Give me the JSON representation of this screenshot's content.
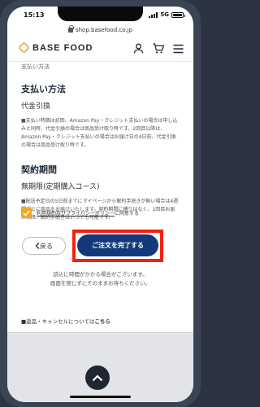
{
  "status": {
    "time": "15:13",
    "network": "5G"
  },
  "browser": {
    "url": "shop.basefood.co.jp"
  },
  "header": {
    "logo_text": "BASE FOOD"
  },
  "content": {
    "cut_text": "支払い方法",
    "payment_title": "支払い方法",
    "payment_value": "代金引換",
    "payment_note": "■支払い時期は初回、Amazon Pay・クレジット支払いの場合は申し込みと同時、代金引換の場合は商品受け取り時です。2回目以降は、Amazon Pay・クレジット支払いの場合はお届け日の4日前、代金引換の場合は商品受け取り時です。",
    "period_title": "契約期間",
    "period_value": "無期限(定期購入コース)",
    "period_note": "■配送予定日の5日前までにマイページから解約手続きが無い場合は4週間ごとに商品をお届けいたします。契約期間に縛りはなく、1回目お届け以降、解約手続きはいつでも可能です。"
  },
  "agree": {
    "link_text": "利用規約及びプライバシーポリシー",
    "suffix": "に同意する"
  },
  "buttons": {
    "back_label": "戻る",
    "submit_label": "ご注文を完了する"
  },
  "wait_text": {
    "line1": "読込に時間がかかる場合がございます。",
    "line2": "画面を閉じずにそのままお待ちください。"
  },
  "returns": {
    "text": "■返品・キャンセルについては",
    "link": "こちら"
  },
  "colors": {
    "accent": "#f0a920",
    "submit_bg": "#14397a",
    "highlight": "#f2200c"
  }
}
